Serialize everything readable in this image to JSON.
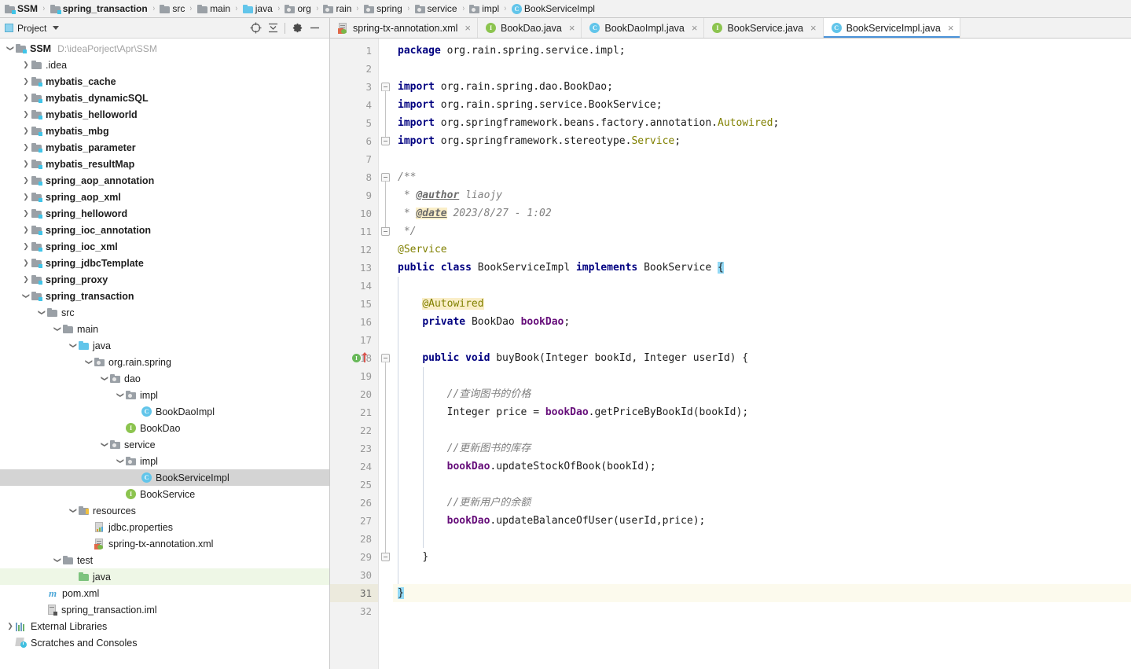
{
  "breadcrumb": {
    "items": [
      {
        "label": "SSM",
        "icon": "module-folder-icon",
        "bold": true,
        "kind": "module"
      },
      {
        "label": "spring_transaction",
        "icon": "module-folder-icon",
        "bold": true,
        "kind": "module"
      },
      {
        "label": "src",
        "icon": "folder-icon",
        "bold": false,
        "kind": "folder"
      },
      {
        "label": "main",
        "icon": "folder-icon",
        "bold": false,
        "kind": "folder"
      },
      {
        "label": "java",
        "icon": "source-folder-icon",
        "bold": false,
        "kind": "source"
      },
      {
        "label": "org",
        "icon": "package-icon",
        "bold": false,
        "kind": "package"
      },
      {
        "label": "rain",
        "icon": "package-icon",
        "bold": false,
        "kind": "package"
      },
      {
        "label": "spring",
        "icon": "package-icon",
        "bold": false,
        "kind": "package"
      },
      {
        "label": "service",
        "icon": "package-icon",
        "bold": false,
        "kind": "package"
      },
      {
        "label": "impl",
        "icon": "package-icon",
        "bold": false,
        "kind": "package"
      },
      {
        "label": "BookServiceImpl",
        "icon": "class-icon",
        "bold": false,
        "kind": "class"
      }
    ],
    "separator": "›"
  },
  "project_toolbar": {
    "title": "Project",
    "dropdown_icon": "chevron-down-icon",
    "buttons": [
      {
        "name": "select-opened-file-icon",
        "glyph": "locate-target"
      },
      {
        "name": "collapse-all-icon",
        "glyph": "collapse-all"
      },
      {
        "name": "settings-gear-icon",
        "glyph": "gear"
      },
      {
        "name": "hide-panel-icon",
        "glyph": "minus"
      }
    ]
  },
  "project_tree": [
    {
      "label": "SSM",
      "path": "D:\\ideaPorject\\Apr\\SSM",
      "depth": 0,
      "twist": "expanded",
      "icon": "module-folder-icon",
      "bold": true
    },
    {
      "label": ".idea",
      "depth": 1,
      "twist": "collapsed",
      "icon": "folder-icon",
      "bold": false
    },
    {
      "label": "mybatis_cache",
      "depth": 1,
      "twist": "collapsed",
      "icon": "module-folder-icon",
      "bold": true
    },
    {
      "label": "mybatis_dynamicSQL",
      "depth": 1,
      "twist": "collapsed",
      "icon": "module-folder-icon",
      "bold": true
    },
    {
      "label": "mybatis_helloworld",
      "depth": 1,
      "twist": "collapsed",
      "icon": "module-folder-icon",
      "bold": true
    },
    {
      "label": "mybatis_mbg",
      "depth": 1,
      "twist": "collapsed",
      "icon": "module-folder-icon",
      "bold": true
    },
    {
      "label": "mybatis_parameter",
      "depth": 1,
      "twist": "collapsed",
      "icon": "module-folder-icon",
      "bold": true
    },
    {
      "label": "mybatis_resultMap",
      "depth": 1,
      "twist": "collapsed",
      "icon": "module-folder-icon",
      "bold": true
    },
    {
      "label": "spring_aop_annotation",
      "depth": 1,
      "twist": "collapsed",
      "icon": "module-folder-icon",
      "bold": true
    },
    {
      "label": "spring_aop_xml",
      "depth": 1,
      "twist": "collapsed",
      "icon": "module-folder-icon",
      "bold": true
    },
    {
      "label": "spring_helloword",
      "depth": 1,
      "twist": "collapsed",
      "icon": "module-folder-icon",
      "bold": true
    },
    {
      "label": "spring_ioc_annotation",
      "depth": 1,
      "twist": "collapsed",
      "icon": "module-folder-icon",
      "bold": true
    },
    {
      "label": "spring_ioc_xml",
      "depth": 1,
      "twist": "collapsed",
      "icon": "module-folder-icon",
      "bold": true
    },
    {
      "label": "spring_jdbcTemplate",
      "depth": 1,
      "twist": "collapsed",
      "icon": "module-folder-icon",
      "bold": true
    },
    {
      "label": "spring_proxy",
      "depth": 1,
      "twist": "collapsed",
      "icon": "module-folder-icon",
      "bold": true
    },
    {
      "label": "spring_transaction",
      "depth": 1,
      "twist": "expanded",
      "icon": "module-folder-icon",
      "bold": true
    },
    {
      "label": "src",
      "depth": 2,
      "twist": "expanded",
      "icon": "folder-icon",
      "bold": false
    },
    {
      "label": "main",
      "depth": 3,
      "twist": "expanded",
      "icon": "folder-icon",
      "bold": false
    },
    {
      "label": "java",
      "depth": 4,
      "twist": "expanded",
      "icon": "source-folder-icon",
      "bold": false
    },
    {
      "label": "org.rain.spring",
      "depth": 5,
      "twist": "expanded",
      "icon": "package-icon",
      "bold": false
    },
    {
      "label": "dao",
      "depth": 6,
      "twist": "expanded",
      "icon": "package-icon",
      "bold": false
    },
    {
      "label": "impl",
      "depth": 7,
      "twist": "expanded",
      "icon": "package-icon",
      "bold": false
    },
    {
      "label": "BookDaoImpl",
      "depth": 8,
      "twist": "none",
      "icon": "class-icon",
      "bold": false
    },
    {
      "label": "BookDao",
      "depth": 7,
      "twist": "none",
      "icon": "interface-icon",
      "bold": false
    },
    {
      "label": "service",
      "depth": 6,
      "twist": "expanded",
      "icon": "package-icon",
      "bold": false
    },
    {
      "label": "impl",
      "depth": 7,
      "twist": "expanded",
      "icon": "package-icon",
      "bold": false
    },
    {
      "label": "BookServiceImpl",
      "depth": 8,
      "twist": "none",
      "icon": "class-icon",
      "bold": false,
      "selected": true
    },
    {
      "label": "BookService",
      "depth": 7,
      "twist": "none",
      "icon": "interface-icon",
      "bold": false
    },
    {
      "label": "resources",
      "depth": 4,
      "twist": "expanded",
      "icon": "resources-folder-icon",
      "bold": false
    },
    {
      "label": "jdbc.properties",
      "depth": 5,
      "twist": "none",
      "icon": "properties-file-icon",
      "bold": false
    },
    {
      "label": "spring-tx-annotation.xml",
      "depth": 5,
      "twist": "none",
      "icon": "spring-xml-file-icon",
      "bold": false
    },
    {
      "label": "test",
      "depth": 3,
      "twist": "expanded",
      "icon": "folder-icon",
      "bold": false
    },
    {
      "label": "java",
      "depth": 4,
      "twist": "none",
      "icon": "test-source-folder-icon",
      "bold": false,
      "green": true
    },
    {
      "label": "pom.xml",
      "depth": 2,
      "twist": "none",
      "icon": "maven-icon",
      "bold": false
    },
    {
      "label": "spring_transaction.iml",
      "depth": 2,
      "twist": "none",
      "icon": "iml-file-icon",
      "bold": false
    },
    {
      "label": "External Libraries",
      "depth": 0,
      "twist": "collapsed",
      "icon": "libraries-icon",
      "bold": false
    },
    {
      "label": "Scratches and Consoles",
      "depth": 0,
      "twist": "none",
      "icon": "scratches-icon",
      "bold": false
    }
  ],
  "editor_tabs": [
    {
      "label": "spring-tx-annotation.xml",
      "icon": "spring-xml-file-icon",
      "active": false,
      "close_icon": "×"
    },
    {
      "label": "BookDao.java",
      "icon": "interface-icon",
      "active": false,
      "close_icon": "×"
    },
    {
      "label": "BookDaoImpl.java",
      "icon": "class-icon",
      "active": false,
      "close_icon": "×"
    },
    {
      "label": "BookService.java",
      "icon": "interface-icon",
      "active": false,
      "close_icon": "×"
    },
    {
      "label": "BookServiceImpl.java",
      "icon": "class-icon",
      "active": true,
      "close_icon": "×"
    }
  ],
  "editor": {
    "file": "BookServiceImpl.java",
    "current_line": 31,
    "first_line": 1,
    "last_line": 32,
    "gutter_marker_line": 18,
    "gutter_marker_icons": [
      "implements-interface-icon",
      "overriding-method-arrow-icon"
    ],
    "lines": [
      {
        "n": 1,
        "tokens": [
          {
            "t": "package ",
            "c": "kw"
          },
          {
            "t": "org.rain.spring.service.impl;",
            "c": "pln"
          }
        ],
        "indent": 0
      },
      {
        "n": 2,
        "tokens": [],
        "indent": 0
      },
      {
        "n": 3,
        "tokens": [
          {
            "t": "import ",
            "c": "kw"
          },
          {
            "t": "org.rain.spring.dao.BookDao;",
            "c": "pln"
          }
        ],
        "indent": 0
      },
      {
        "n": 4,
        "tokens": [
          {
            "t": "import ",
            "c": "kw"
          },
          {
            "t": "org.rain.spring.service.BookService;",
            "c": "pln"
          }
        ],
        "indent": 0
      },
      {
        "n": 5,
        "tokens": [
          {
            "t": "import ",
            "c": "kw"
          },
          {
            "t": "org.springframework.beans.factory.annotation.",
            "c": "pln"
          },
          {
            "t": "Autowired",
            "c": "ann"
          },
          {
            "t": ";",
            "c": "pln"
          }
        ],
        "indent": 0
      },
      {
        "n": 6,
        "tokens": [
          {
            "t": "import ",
            "c": "kw"
          },
          {
            "t": "org.springframework.stereotype.",
            "c": "pln"
          },
          {
            "t": "Service",
            "c": "ann"
          },
          {
            "t": ";",
            "c": "pln"
          }
        ],
        "indent": 0
      },
      {
        "n": 7,
        "tokens": [],
        "indent": 0
      },
      {
        "n": 8,
        "tokens": [
          {
            "t": "/**",
            "c": "doc"
          }
        ],
        "indent": 0
      },
      {
        "n": 9,
        "tokens": [
          {
            "t": " * ",
            "c": "doc"
          },
          {
            "t": "@author",
            "c": "doctag"
          },
          {
            "t": " liaojy",
            "c": "doc"
          }
        ],
        "indent": 0
      },
      {
        "n": 10,
        "tokens": [
          {
            "t": " * ",
            "c": "doc"
          },
          {
            "t": "@date",
            "c": "doctag-hl"
          },
          {
            "t": " 2023/8/27 - 1:02",
            "c": "doc"
          }
        ],
        "indent": 0
      },
      {
        "n": 11,
        "tokens": [
          {
            "t": " */",
            "c": "doc"
          }
        ],
        "indent": 0
      },
      {
        "n": 12,
        "tokens": [
          {
            "t": "@Service",
            "c": "ann"
          }
        ],
        "indent": 0
      },
      {
        "n": 13,
        "tokens": [
          {
            "t": "public class ",
            "c": "kw"
          },
          {
            "t": "BookServiceImpl ",
            "c": "pln"
          },
          {
            "t": "implements ",
            "c": "kw"
          },
          {
            "t": "BookService ",
            "c": "pln"
          },
          {
            "t": "{",
            "c": "hl-brace"
          }
        ],
        "indent": 0
      },
      {
        "n": 14,
        "tokens": [],
        "indent": 0
      },
      {
        "n": 15,
        "tokens": [
          {
            "t": "    ",
            "c": "pln"
          },
          {
            "t": "@Autowired",
            "c": "ann-hl"
          }
        ],
        "indent": 1
      },
      {
        "n": 16,
        "tokens": [
          {
            "t": "    ",
            "c": "pln"
          },
          {
            "t": "private ",
            "c": "kw"
          },
          {
            "t": "BookDao ",
            "c": "pln"
          },
          {
            "t": "bookDao",
            "c": "fld"
          },
          {
            "t": ";",
            "c": "pln"
          }
        ],
        "indent": 1
      },
      {
        "n": 17,
        "tokens": [],
        "indent": 1
      },
      {
        "n": 18,
        "tokens": [
          {
            "t": "    ",
            "c": "pln"
          },
          {
            "t": "public void ",
            "c": "kw"
          },
          {
            "t": "buyBook(Integer bookId, Integer userId) {",
            "c": "pln"
          }
        ],
        "indent": 1
      },
      {
        "n": 19,
        "tokens": [],
        "indent": 2
      },
      {
        "n": 20,
        "tokens": [
          {
            "t": "        ",
            "c": "pln"
          },
          {
            "t": "//查询图书的价格",
            "c": "cmt"
          }
        ],
        "indent": 2
      },
      {
        "n": 21,
        "tokens": [
          {
            "t": "        ",
            "c": "pln"
          },
          {
            "t": "Integer price = ",
            "c": "pln"
          },
          {
            "t": "bookDao",
            "c": "fld"
          },
          {
            "t": ".getPriceByBookId(bookId);",
            "c": "pln"
          }
        ],
        "indent": 2
      },
      {
        "n": 22,
        "tokens": [],
        "indent": 2
      },
      {
        "n": 23,
        "tokens": [
          {
            "t": "        ",
            "c": "pln"
          },
          {
            "t": "//更新图书的库存",
            "c": "cmt"
          }
        ],
        "indent": 2
      },
      {
        "n": 24,
        "tokens": [
          {
            "t": "        ",
            "c": "pln"
          },
          {
            "t": "bookDao",
            "c": "fld"
          },
          {
            "t": ".updateStockOfBook(bookId);",
            "c": "pln"
          }
        ],
        "indent": 2
      },
      {
        "n": 25,
        "tokens": [],
        "indent": 2
      },
      {
        "n": 26,
        "tokens": [
          {
            "t": "        ",
            "c": "pln"
          },
          {
            "t": "//更新用户的余额",
            "c": "cmt"
          }
        ],
        "indent": 2
      },
      {
        "n": 27,
        "tokens": [
          {
            "t": "        ",
            "c": "pln"
          },
          {
            "t": "bookDao",
            "c": "fld"
          },
          {
            "t": ".updateBalanceOfUser(userId,price);",
            "c": "pln"
          }
        ],
        "indent": 2
      },
      {
        "n": 28,
        "tokens": [],
        "indent": 2
      },
      {
        "n": 29,
        "tokens": [
          {
            "t": "    ",
            "c": "pln"
          },
          {
            "t": "}",
            "c": "pln"
          }
        ],
        "indent": 1
      },
      {
        "n": 30,
        "tokens": [],
        "indent": 0
      },
      {
        "n": 31,
        "tokens": [
          {
            "t": "}",
            "c": "hl-brace"
          }
        ],
        "indent": 0
      },
      {
        "n": 32,
        "tokens": [],
        "indent": 0
      }
    ]
  },
  "colors": {
    "keyword": "#000080",
    "annotation": "#808000",
    "comment": "#808080",
    "field": "#660e7a",
    "plain": "#1d1d1d",
    "selection_row": "#d4d4d4",
    "test_source_row": "#eef7e6",
    "current_line": "#fcfaed",
    "brace_match": "#93d9f5",
    "annotation_highlight": "#faeec8",
    "active_tab_underline": "#4a93d9",
    "panel_bg": "#f2f2f2"
  }
}
